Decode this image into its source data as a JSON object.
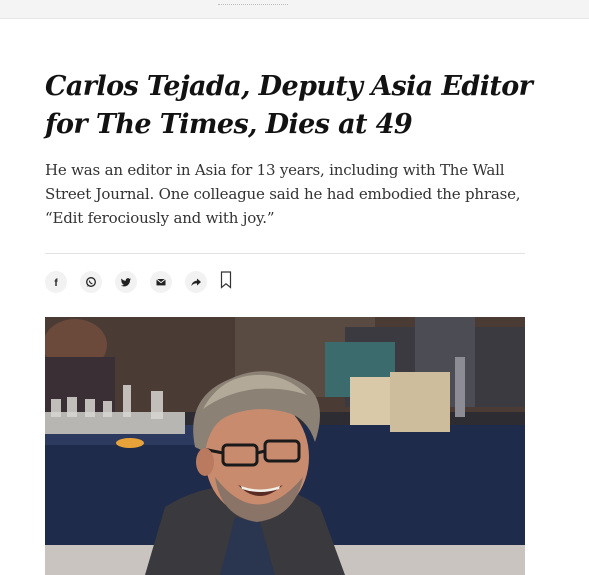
{
  "article": {
    "headline": "Carlos Tejada, Deputy Asia Editor for The Times, Dies at 49",
    "summary": "He was an editor in Asia for 13 years, including with The Wall Street Journal. One colleague said he had embodied the phrase, “Edit ferociously and with joy.”"
  },
  "share": {
    "buttons": [
      {
        "name": "facebook-icon",
        "glyph": "f"
      },
      {
        "name": "whatsapp-icon",
        "glyph": "whatsapp"
      },
      {
        "name": "twitter-icon",
        "glyph": "twitter"
      },
      {
        "name": "email-icon",
        "glyph": "envelope"
      },
      {
        "name": "share-arrow-icon",
        "glyph": "arrow"
      }
    ],
    "bookmark_icon": "bookmark-icon"
  },
  "colors": {
    "headline": "#121212",
    "summary": "#333333",
    "icon_bg": "#f2f2f2"
  }
}
